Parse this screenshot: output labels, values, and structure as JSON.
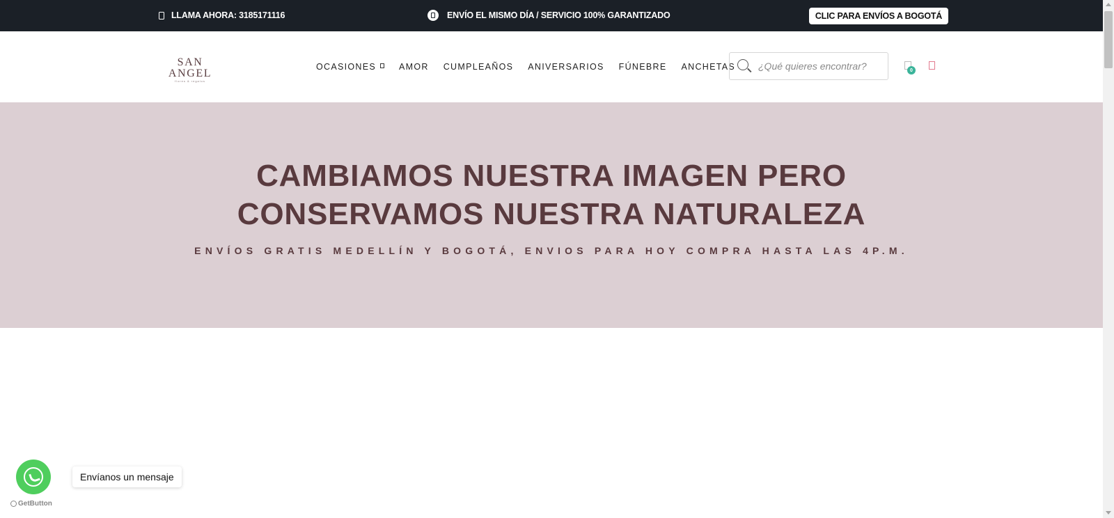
{
  "topbar": {
    "call_label": "LLAMA AHORA: 3185171116",
    "call_icon": "phone-icon",
    "shipping_label": "ENVÍO EL MISMO DÍA / SERVICIO 100% GARANTIZADO",
    "shipping_icon": "clipboard-icon",
    "bogota_button": "CLIC PARA ENVÍOS A BOGOTÁ",
    "background_color": "#1b2027"
  },
  "header": {
    "logo_text": "SAN ANGEL",
    "logo_subtext": "flores & regalos",
    "nav": [
      {
        "label": "OCASIONES",
        "has_dropdown": true
      },
      {
        "label": "AMOR"
      },
      {
        "label": "CUMPLEAÑOS"
      },
      {
        "label": "ANIVERSARIOS"
      },
      {
        "label": "FÚNEBRE"
      },
      {
        "label": "ANCHETAS"
      }
    ],
    "search_placeholder": "¿Qué quieres encontrar?",
    "search_icon": "search-icon",
    "cart_icon": "cart-icon",
    "cart_count": "0",
    "wishlist_icon": "heart-icon",
    "badge_color": "#3bb49a"
  },
  "hero": {
    "title_line1": "CAMBIAMOS NUESTRA IMAGEN PERO",
    "title_line2": "CONSERVAMOS NUESTRA NATURALEZA",
    "subtitle": "ENVÍOS GRATIS MEDELLÍN Y BOGOTÁ, ENVIOS PARA HOY COMPRA HASTA LAS 4P.M.",
    "background_color": "#dccfd3",
    "text_color": "#593a3e"
  },
  "whatsapp": {
    "tooltip": "Envíanos un mensaje",
    "icon": "whatsapp-icon",
    "powered_by": "GetButton",
    "color": "#4fce5d"
  }
}
